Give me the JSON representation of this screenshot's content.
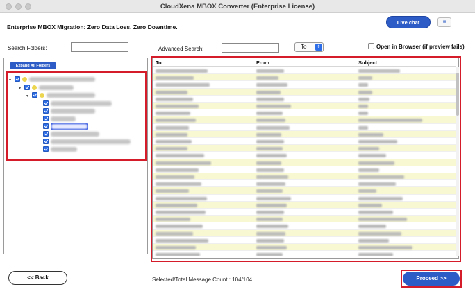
{
  "window": {
    "title": "CloudXena MBOX Converter (Enterprise License)"
  },
  "header": {
    "tagline": "Enterprise MBOX Migration: Zero Data Loss. Zero Downtime.",
    "live_chat_label": "Live chat",
    "menu_icon": "hamburger-icon",
    "menu_glyph": "≡"
  },
  "search": {
    "folders_label": "Search Folders:",
    "folders_value": "",
    "advanced_label": "Advanced Search:",
    "advanced_value": "",
    "field_select_value": "To",
    "open_in_browser_label": "Open in Browser (if preview fails)"
  },
  "folder_tree": {
    "expand_all_label": "Expand All Folders"
  },
  "grid": {
    "columns": [
      "To",
      "From",
      "Subject"
    ],
    "row_count_visible": 27
  },
  "footer": {
    "back_label": "<< Back",
    "count_label": "Selected/Total Message Count : 104/104",
    "proceed_label": "Proceed >>"
  },
  "colors": {
    "accent": "#2d5cc7",
    "highlight_border": "#d41c2b",
    "row_alt": "#f8f8d2"
  }
}
